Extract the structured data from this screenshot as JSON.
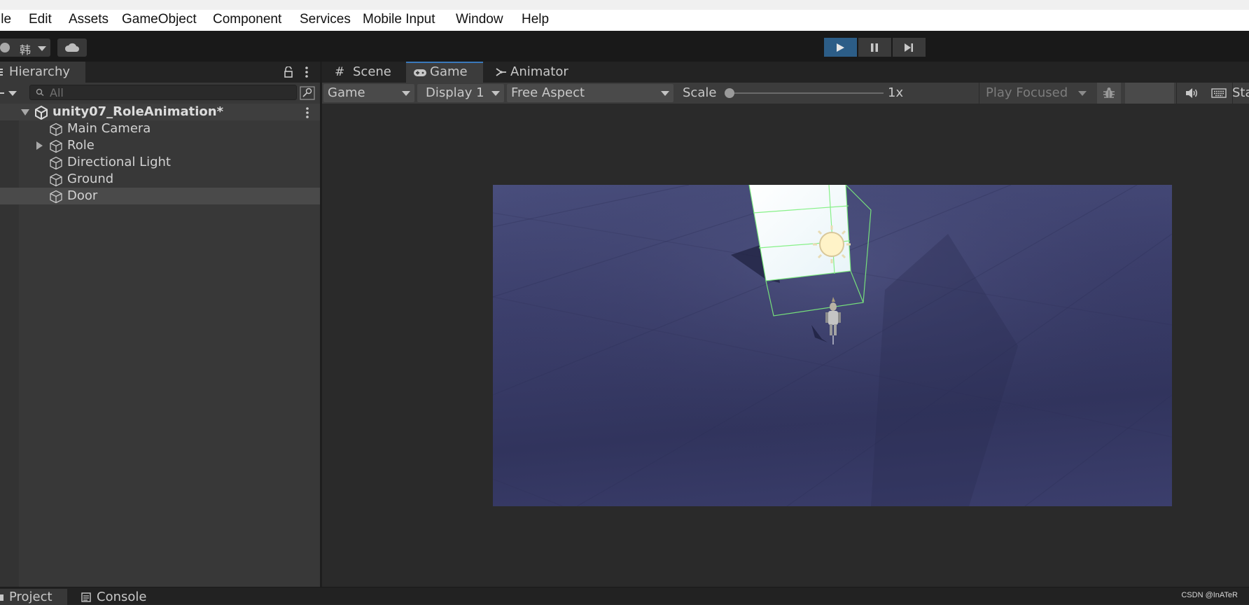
{
  "menu": {
    "items": [
      "ile",
      "Edit",
      "Assets",
      "GameObject",
      "Component",
      "Services",
      "Mobile Input",
      "Window",
      "Help"
    ]
  },
  "toolbar": {
    "account_name": "韩",
    "play_icon": "play-icon",
    "pause_icon": "pause-icon",
    "step_icon": "step-icon",
    "play_active": true
  },
  "hierarchy": {
    "tab_label": "Hierarchy",
    "search_placeholder": "All",
    "scene_name": "unity07_RoleAnimation*",
    "items": [
      {
        "label": "Main Camera",
        "expandable": false,
        "selected": false
      },
      {
        "label": "Role",
        "expandable": true,
        "selected": false
      },
      {
        "label": "Directional Light",
        "expandable": false,
        "selected": false
      },
      {
        "label": "Ground",
        "expandable": false,
        "selected": false
      },
      {
        "label": "Door",
        "expandable": false,
        "selected": true
      }
    ]
  },
  "tabs": {
    "scene": "Scene",
    "game": "Game",
    "animator": "Animator",
    "active": "Game"
  },
  "game_toolbar": {
    "mode": "Game",
    "display": "Display 1",
    "aspect": "Free Aspect",
    "scale_label": "Scale",
    "scale_value": "1x",
    "scale_fraction": 0.0,
    "play_mode": "Play Focused",
    "stats_label": "Sta"
  },
  "bottom": {
    "project": "Project",
    "console": "Console"
  },
  "watermark": "CSDN @InATeR",
  "colors": {
    "play_active": "#2c5d87",
    "tab_accent": "#3a79bb",
    "selection_outline": "#7cf07c"
  }
}
